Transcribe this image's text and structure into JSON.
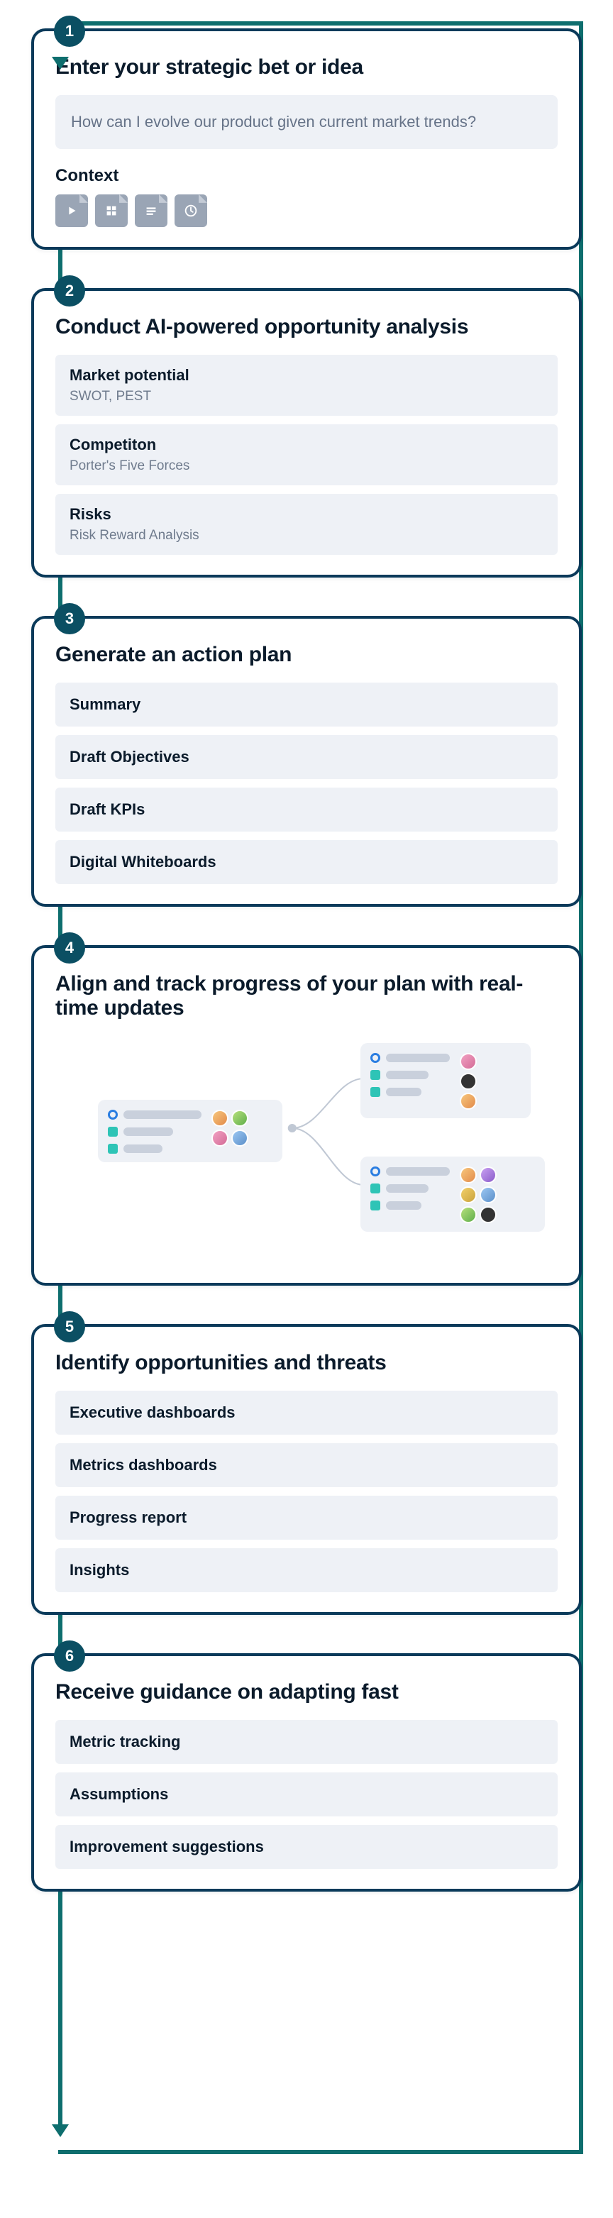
{
  "steps": [
    {
      "num": "1",
      "title": "Enter your strategic bet or idea",
      "input_placeholder": "How can I evolve our product given current market trends?",
      "context_label": "Context",
      "icons": [
        "play-file-icon",
        "grid-file-icon",
        "lines-file-icon",
        "clock-file-icon"
      ]
    },
    {
      "num": "2",
      "title": "Conduct AI-powered opportunity analysis",
      "blocks": [
        {
          "title": "Market potential",
          "desc": "SWOT, PEST"
        },
        {
          "title": "Competiton",
          "desc": "Porter's Five Forces"
        },
        {
          "title": "Risks",
          "desc": "Risk Reward Analysis"
        }
      ]
    },
    {
      "num": "3",
      "title": "Generate an action plan",
      "items": [
        "Summary",
        "Draft Objectives",
        "Draft KPIs",
        "Digital Whiteboards"
      ]
    },
    {
      "num": "4",
      "title": "Align and track progress of your plan with real-time updates"
    },
    {
      "num": "5",
      "title": "Identify opportunities and threats",
      "items": [
        "Executive dashboards",
        "Metrics dashboards",
        "Progress report",
        "Insights"
      ]
    },
    {
      "num": "6",
      "title": "Receive guidance on adapting fast",
      "items": [
        "Metric tracking",
        "Assumptions",
        "Improvement suggestions"
      ]
    }
  ]
}
